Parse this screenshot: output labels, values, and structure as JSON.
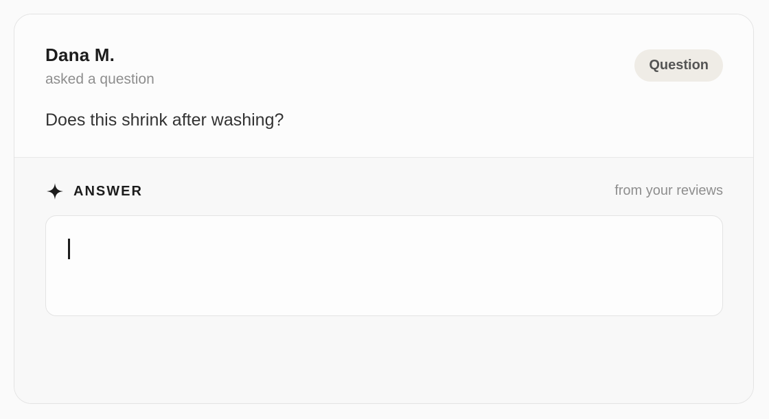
{
  "question": {
    "author": "Dana M.",
    "action": "asked a question",
    "badge": "Question",
    "text": "Does this shrink after washing?"
  },
  "answer": {
    "label": "ANSWER",
    "source": "from your reviews",
    "value": "",
    "icon": "sparkle-icon"
  }
}
